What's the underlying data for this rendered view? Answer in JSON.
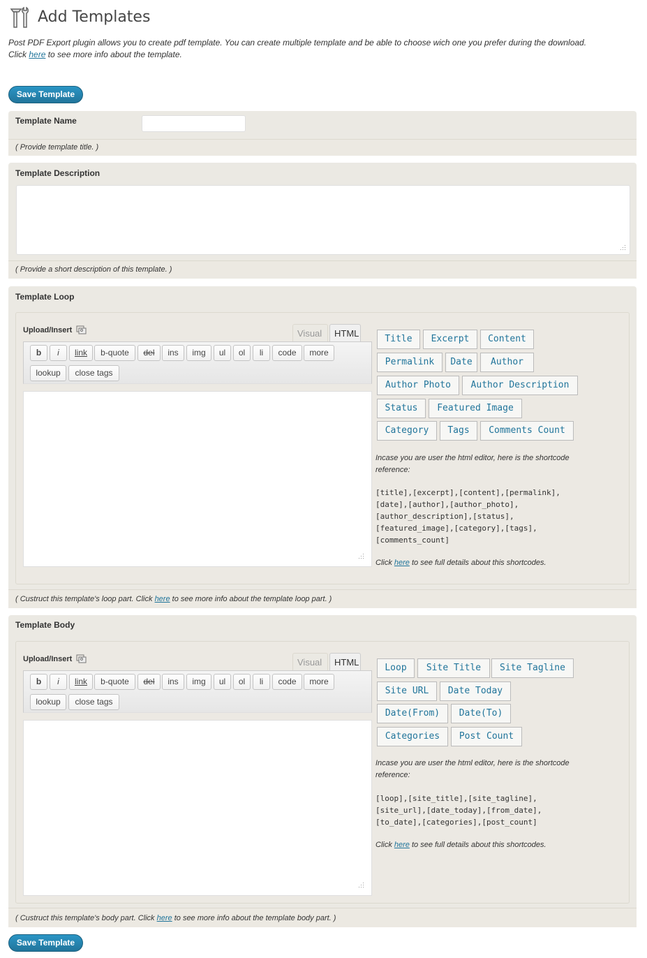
{
  "page": {
    "title": "Add Templates",
    "icon": "tools-icon",
    "intro_line1": "Post PDF Export plugin allows you to create pdf template. You can create multiple template and be able to choose wich one you prefer during the download.",
    "intro_click": "Click ",
    "intro_link": "here",
    "intro_after": " to see more info about the template."
  },
  "actions": {
    "save_label": "Save Template"
  },
  "template_name": {
    "label": "Template Name",
    "value": "",
    "note": "( Provide template title. )"
  },
  "template_description": {
    "label": "Template Description",
    "value": "",
    "note": "( Provide a short description of this template. )"
  },
  "editor_common": {
    "upload_label": "Upload/Insert",
    "tab_visual": "Visual",
    "tab_html": "HTML",
    "buttons": [
      "b",
      "i",
      "link",
      "b-quote",
      "del",
      "ins",
      "img",
      "ul",
      "ol",
      "li",
      "code",
      "more",
      "lookup",
      "close tags"
    ]
  },
  "template_loop": {
    "label": "Template Loop",
    "shortcode_buttons": [
      "Title",
      "Excerpt",
      "Content",
      "Permalink",
      "Date",
      "Author",
      "Author Photo",
      "Author Description",
      "Status",
      "Featured Image",
      "Category",
      "Tags",
      "Comments Count"
    ],
    "ref_text": "Incase you are user the html editor, here is the shortcode reference:",
    "ref_codes": "[title],[excerpt],[content],[permalink],\n[date],[author],[author_photo],\n[author_description],[status],\n[featured_image],[category],[tags],\n[comments_count]",
    "details_click": "Click ",
    "details_link": "here",
    "details_after": " to see full details about this shortcodes.",
    "note_before": "( Custruct this template's loop part. Click ",
    "note_link": "here",
    "note_after": " to see more info about the template loop part. )"
  },
  "template_body": {
    "label": "Template Body",
    "shortcode_buttons": [
      "Loop",
      "Site Title",
      "Site Tagline",
      "Site URL",
      "Date Today",
      "Date(From)",
      "Date(To)",
      "Categories",
      "Post Count"
    ],
    "ref_text": "Incase you are user the html editor, here is the shortcode reference:",
    "ref_codes": "[loop],[site_title],[site_tagline],\n[site_url],[date_today],[from_date],\n[to_date],[categories],[post_count]",
    "details_click": "Click ",
    "details_link": "here",
    "details_after": " to see full details about this shortcodes.",
    "note_before": "( Custruct this template's body part. Click ",
    "note_link": "here",
    "note_after": " to see more info about the template body part. )"
  },
  "colors": {
    "accent": "#21759b",
    "panel": "#ebe9e3"
  }
}
